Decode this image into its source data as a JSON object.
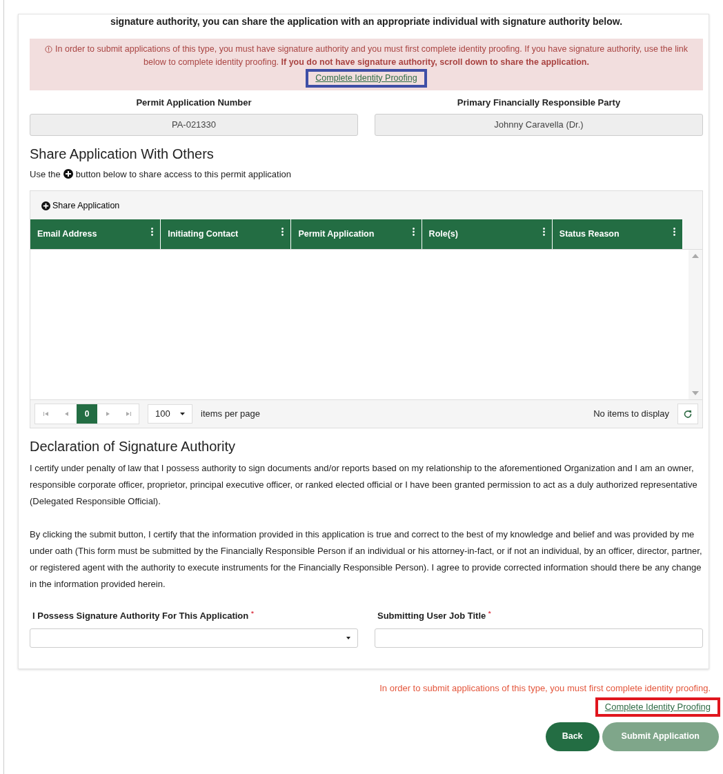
{
  "intro": "signature authority, you can share the application with an appropriate individual with signature authority below.",
  "alert": {
    "text": "In order to submit applications of this type, you must have signature authority and you must first complete identity proofing. If you have signature authority, use the link below to complete identity proofing. **If you do not have signature authority, scroll down to share the application.**",
    "link": "Complete Identity Proofing"
  },
  "summary_fields": [
    {
      "label": "Permit Application Number",
      "value": "PA-021330"
    },
    {
      "label": "Primary Financially Responsible Party",
      "value": "Johnny Caravella (Dr.)"
    }
  ],
  "share": {
    "title": "Share Application With Others",
    "hint_before": "Use the",
    "hint_after": "button below to share access to this permit application",
    "toolbar_button": "Share Application",
    "table": {
      "columns": [
        "Email Address",
        "Initiating Contact",
        "Permit Application",
        "Role(s)",
        "Status Reason"
      ]
    },
    "pager": {
      "page": "0",
      "page_size": "100",
      "page_size_label": "items per page",
      "status": "No items to display"
    }
  },
  "declaration": {
    "title": "Declaration of Signature Authority",
    "paragraphs": [
      "I certify under penalty of law that I possess authority to sign documents and/or reports based on my relationship to the aforementioned Organization and I am an owner, responsible corporate officer, proprietor, principal executive officer, or ranked elected official or I have been granted permission to act as a duly authorized representative (Delegated Responsible Official).",
      "By clicking the submit button, I certify that the information provided in this application is true and correct to the best of my knowledge and belief and was provided by me under oath (This form must be submitted by the Financially Responsible Person if an individual or his attorney-in-fact, or if not an individual, by an officer, director, partner, or registered agent with the authority to execute instruments for the Financially Responsible Person). I agree to provide corrected information should there be any change in the information provided herein."
    ],
    "fields": [
      {
        "kind": "select",
        "label": "I Possess Signature Authority For This Application",
        "required_mark": "*"
      },
      {
        "kind": "text",
        "label": "Submitting User Job Title",
        "required_mark": "*"
      }
    ]
  },
  "footer": {
    "error": "In order to submit applications of this type, you must first complete identity proofing.",
    "link": "Complete Identity Proofing",
    "buttons": [
      {
        "label": "Back",
        "disabled": false
      },
      {
        "label": "Submit Application",
        "disabled": true
      }
    ]
  }
}
